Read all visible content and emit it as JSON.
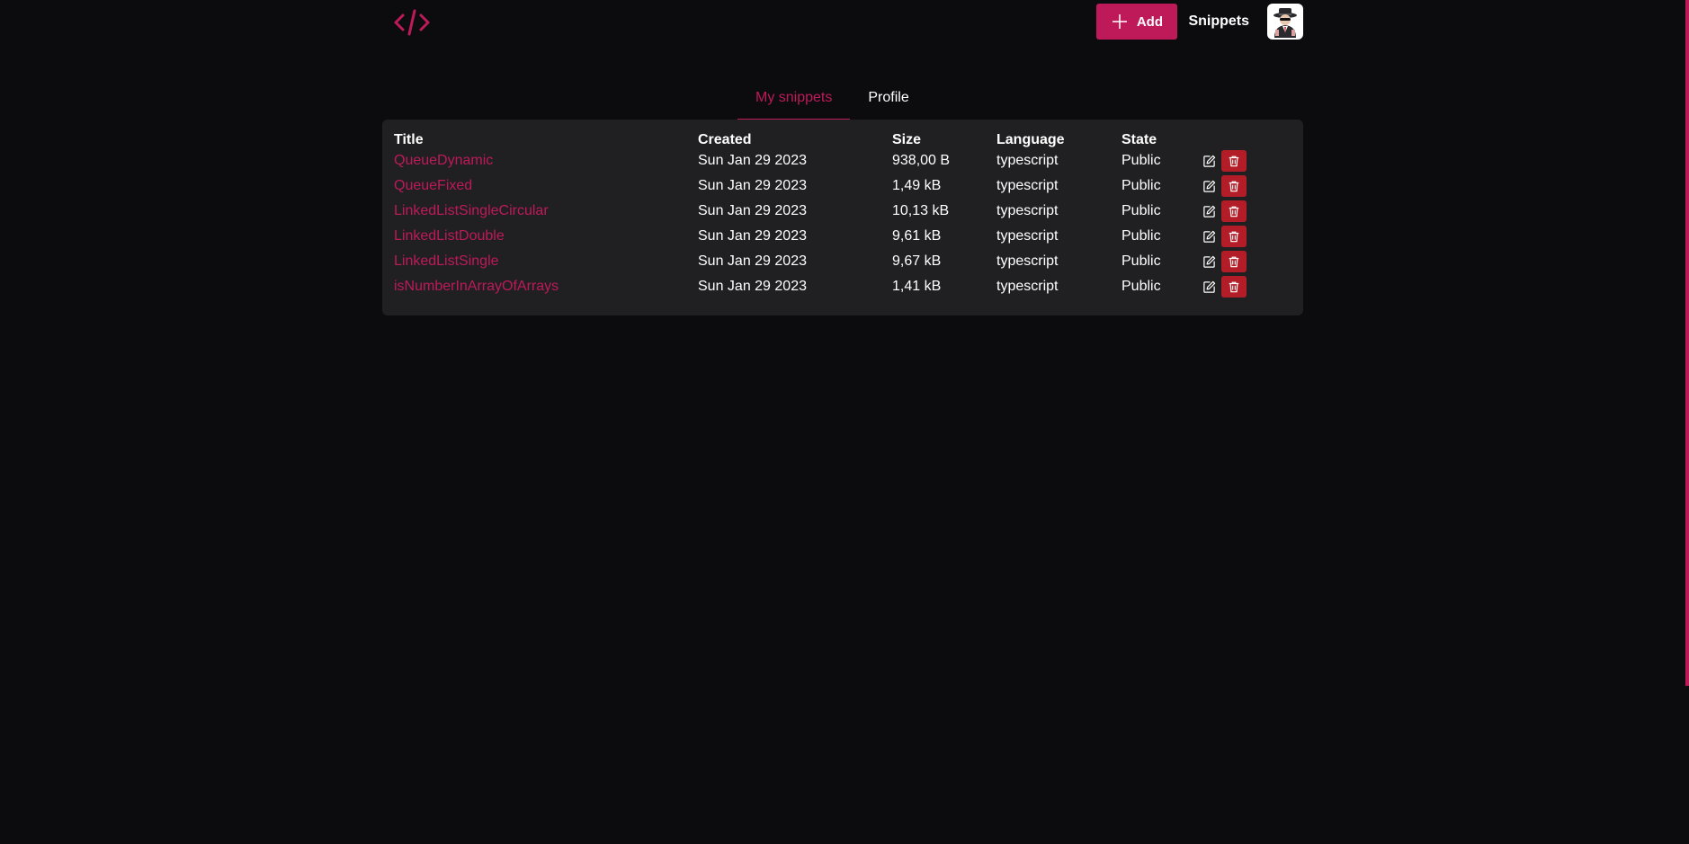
{
  "header": {
    "logo_icon": "code-brackets-icon",
    "add_label": "Add",
    "nav_snippets": "Snippets",
    "avatar_icon": "spy-avatar-icon"
  },
  "tabs": [
    {
      "label": "My snippets",
      "active": true
    },
    {
      "label": "Profile",
      "active": false
    }
  ],
  "table": {
    "headers": [
      "Title",
      "Created",
      "Size",
      "Language",
      "State"
    ],
    "rows": [
      {
        "title": "QueueDynamic",
        "created": "Sun Jan 29 2023",
        "size": "938,00 B",
        "language": "typescript",
        "state": "Public"
      },
      {
        "title": "QueueFixed",
        "created": "Sun Jan 29 2023",
        "size": "1,49 kB",
        "language": "typescript",
        "state": "Public"
      },
      {
        "title": "LinkedListSingleCircular",
        "created": "Sun Jan 29 2023",
        "size": "10,13 kB",
        "language": "typescript",
        "state": "Public"
      },
      {
        "title": "LinkedListDouble",
        "created": "Sun Jan 29 2023",
        "size": "9,61 kB",
        "language": "typescript",
        "state": "Public"
      },
      {
        "title": "LinkedListSingle",
        "created": "Sun Jan 29 2023",
        "size": "9,67 kB",
        "language": "typescript",
        "state": "Public"
      },
      {
        "title": "isNumberInArrayOfArrays",
        "created": "Sun Jan 29 2023",
        "size": "1,41 kB",
        "language": "typescript",
        "state": "Public"
      }
    ]
  },
  "colors": {
    "accent": "#be1a5a",
    "danger": "#b31d28",
    "background": "#0c0c0e",
    "panel": "#202022"
  }
}
